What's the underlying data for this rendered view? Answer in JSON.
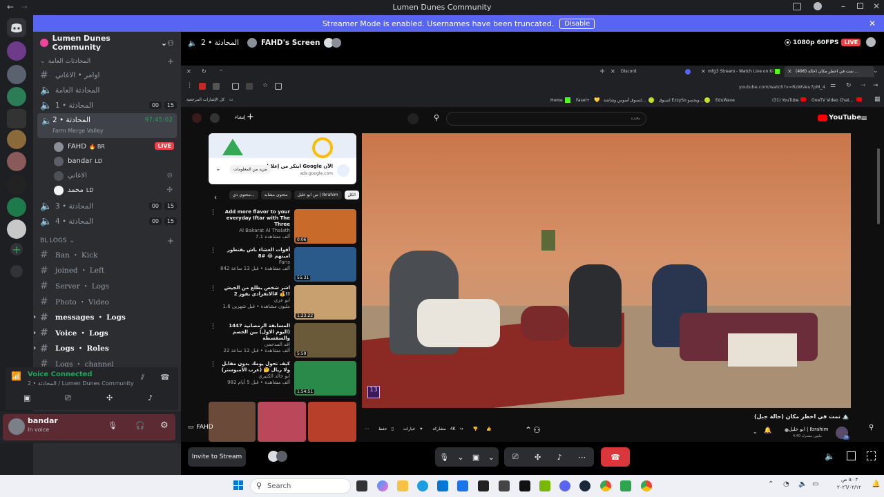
{
  "window": {
    "title": "Lumen Dunes Community"
  },
  "banner": {
    "text": "Streamer Mode is enabled. Usernames have been truncated.",
    "disable_label": "Disable"
  },
  "server": {
    "name": "Lumen Dunes Community"
  },
  "sidebar": {
    "category_general": "المحادثات العامة",
    "channels_top": [
      {
        "type": "text",
        "label": "اوامر • الاغاني"
      },
      {
        "type": "voice",
        "label": "المحادثة العامة"
      },
      {
        "type": "voice",
        "label": "المحادثة • 1",
        "count_a": "00",
        "count_b": "15"
      }
    ],
    "active_voice": {
      "label": "المحادثة • 2",
      "timer": "97:45:02",
      "subtitle": "Farm Merge Valley"
    },
    "voice_users": [
      {
        "name": "FAHD",
        "tag": "BR",
        "live": "LIVE"
      },
      {
        "name": "bandar",
        "tag": "LD"
      },
      {
        "name": "الاغاني"
      },
      {
        "name": "محمد",
        "tag": "LD"
      }
    ],
    "channels_mid": [
      {
        "label": "المحادثة • 3",
        "count_a": "00",
        "count_b": "15"
      },
      {
        "label": "المحادثة • 4",
        "count_a": "00",
        "count_b": "15"
      }
    ],
    "category_logs": "BL LOGS",
    "log_channels": [
      {
        "label": "Ban ・ Kick",
        "bold": false
      },
      {
        "label": "joined ・ Left",
        "bold": false
      },
      {
        "label": "Server ・ Logs",
        "bold": false
      },
      {
        "label": "Photo ・ Video",
        "bold": false
      },
      {
        "label": "messages ・ Logs",
        "bold": true
      },
      {
        "label": "Voice ・ Logs",
        "bold": true
      },
      {
        "label": "Logs ・ Roles",
        "bold": true
      },
      {
        "label": "Logs ・ channel",
        "bold": false
      },
      {
        "label": "Logs",
        "bold": true
      }
    ]
  },
  "voice_panel": {
    "status": "Voice Connected",
    "location": "2 • المحادثة / Lumen Dunes Community"
  },
  "user_bar": {
    "name": "bandar",
    "status": "In voice"
  },
  "stream_header": {
    "channel": "المحادثة • 2",
    "screen": "FAHD's Screen",
    "quality": "1080p 60FPS",
    "live": "LIVE",
    "streamer_label": "FAHD"
  },
  "browser": {
    "tabs": [
      "Discord",
      "mfg3 Stream - Watch Live on Ki",
      "(496) نمت في اخطر مكان (حالة ..."
    ],
    "url": "youtube.com/watch?v=RzWVeu7pM_4",
    "bookmarks": [
      "Home",
      "Fasel+",
      "لتسوق أسوس وشاشة...",
      "لتسوق EzzySo وبحسو...",
      "EduWave",
      "(31) YouTube",
      "OneTV Video Chat..."
    ],
    "bookmark_folder": "كل الإشارات المرجعية"
  },
  "youtube": {
    "logo": "YouTube",
    "ad": {
      "title": "ابتكر من إعلانات Google الآن",
      "domain": "ads.google.com",
      "cta": "مزيد من المعلومات",
      "label": "إعلان"
    },
    "chips": [
      "الكل",
      "من ابو خليل | Ibrahim",
      "محتوى مشابه",
      "محتوى ذي..."
    ],
    "related": [
      {
        "title": "Add more flavor to your everyday Iftar with The Three",
        "channel": "Al Bakarat Al Thalath",
        "meta": "7.1 ألف مشاهدة",
        "duration": "0:06"
      },
      {
        "title": "أقوات العشاء باش يقتطور اميتهم 😂 #8",
        "channel": "Faris",
        "meta": "842 ألف مشاهدة • قبل 13 ساعة",
        "duration": "55:31"
      },
      {
        "title": "اشر شخص يطلع من الجيش الانفرادي يفوز 2# 💰!!",
        "channel": "ابو عزي",
        "meta": "1.6 مليون مشاهدة • قبل شهرين",
        "duration": "1:23:22"
      },
      {
        "title": "المسابقة الرمضانية 1447 (اليوم الاول) بين الخصم والسفسطة",
        "channel": "اقد المدحمي",
        "meta": "22 ألف مشاهدة • قبل 12 ساعة",
        "duration": "5:59"
      },
      {
        "title": "كيف تحول يومك بدون مقابل ولا ريال 🤔 (عرب الأمبوستر)",
        "channel": "ابو خالد الكثيري",
        "meta": "982 ألف مشاهدة • قبل 5 أيام",
        "duration": "1:54:51"
      }
    ],
    "video_title": "نمت في اخطر مكان (حالة جبل) 🏔️",
    "channel_name": "ابو خليل | Ibrahim",
    "subscribers": "4.40 مليون مشترك",
    "subscribe_count": "20",
    "actions": [
      "حفظ",
      "خيارات",
      "مشاركة",
      "4K"
    ],
    "age_badge": "13"
  },
  "controls": {
    "invite": "Invite to Stream"
  },
  "taskbar": {
    "search_placeholder": "Search",
    "time": "٥:٠٣ ص",
    "date": "٢٠٢٦/٠٢/١٢"
  },
  "colors": {
    "blurple": "#5865f2",
    "live_red": "#ed4245",
    "voice_green": "#23a55a",
    "yt_red": "#ff0000"
  }
}
